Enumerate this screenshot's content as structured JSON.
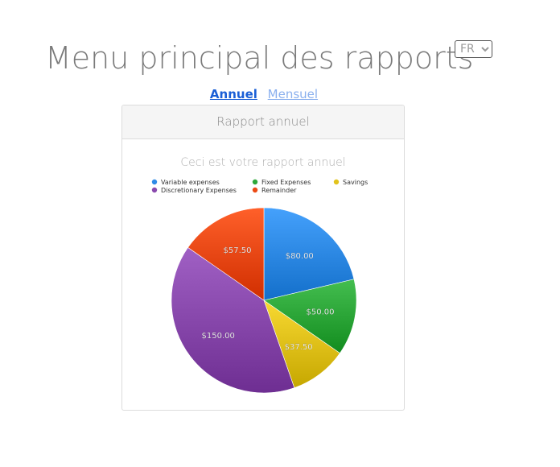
{
  "header": {
    "title": "Menu principal des rapports",
    "language": {
      "selected": "FR",
      "options": [
        "FR"
      ]
    }
  },
  "report_tabs": {
    "annual": "Annuel",
    "monthly": "Mensuel"
  },
  "card": {
    "title": "Rapport annuel"
  },
  "chart_data": {
    "type": "pie",
    "title": "Ceci est votre rapport annuel",
    "legend_placement": "top",
    "slices": [
      {
        "name": "Variable expenses",
        "value": 80.0,
        "label": "$80.00",
        "color": "#2f8be6"
      },
      {
        "name": "Fixed Expenses",
        "value": 50.0,
        "label": "$50.00",
        "color": "#2ea83a"
      },
      {
        "name": "Savings",
        "value": 37.5,
        "label": "$37.50",
        "color": "#e2c31c"
      },
      {
        "name": "Discretionary Expenses",
        "value": 150.0,
        "label": "$150.00",
        "color": "#8a4aae"
      },
      {
        "name": "Remainder",
        "value": 57.5,
        "label": "$57.50",
        "color": "#ec4a14"
      }
    ]
  }
}
